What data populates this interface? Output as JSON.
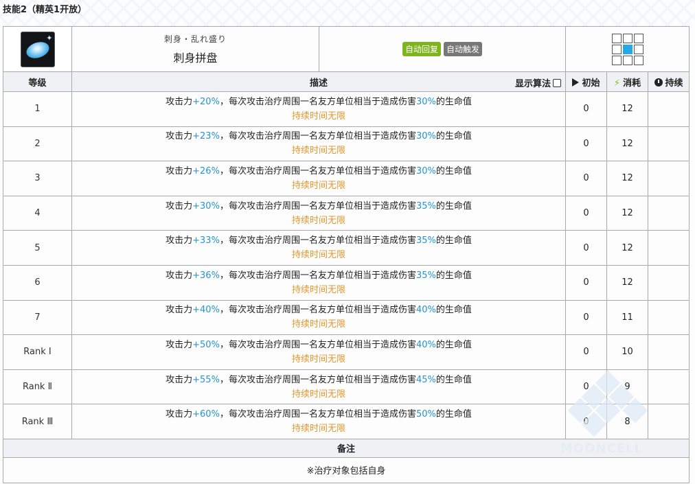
{
  "section_title": "技能2（精英1开放）",
  "skill": {
    "name_jp": "刺身・乱れ盛り",
    "name": "刺身拼盘",
    "tags": [
      {
        "label": "自动回复",
        "color": "#7cb51c"
      },
      {
        "label": "自动触发",
        "color": "#777777"
      }
    ],
    "icon": "sashimi-platter-icon",
    "range_grid": [
      [
        0,
        0,
        0
      ],
      [
        0,
        1,
        0
      ],
      [
        0,
        0,
        0
      ]
    ]
  },
  "columns": {
    "level": "等级",
    "desc": "描述",
    "show_algo": "显示算法",
    "initial": "初始",
    "cost": "消耗",
    "duration": "持续"
  },
  "levels": [
    {
      "level": "1",
      "atk": "+20%",
      "heal": "30%",
      "initial": "0",
      "cost": "12",
      "duration": ""
    },
    {
      "level": "2",
      "atk": "+23%",
      "heal": "30%",
      "initial": "0",
      "cost": "12",
      "duration": ""
    },
    {
      "level": "3",
      "atk": "+26%",
      "heal": "30%",
      "initial": "0",
      "cost": "12",
      "duration": ""
    },
    {
      "level": "4",
      "atk": "+30%",
      "heal": "35%",
      "initial": "0",
      "cost": "12",
      "duration": ""
    },
    {
      "level": "5",
      "atk": "+33%",
      "heal": "35%",
      "initial": "0",
      "cost": "12",
      "duration": ""
    },
    {
      "level": "6",
      "atk": "+36%",
      "heal": "35%",
      "initial": "0",
      "cost": "12",
      "duration": ""
    },
    {
      "level": "7",
      "atk": "+40%",
      "heal": "40%",
      "initial": "0",
      "cost": "11",
      "duration": ""
    },
    {
      "level": "Rank Ⅰ",
      "atk": "+50%",
      "heal": "40%",
      "initial": "0",
      "cost": "10",
      "duration": ""
    },
    {
      "level": "Rank Ⅱ",
      "atk": "+55%",
      "heal": "45%",
      "initial": "0",
      "cost": "9",
      "duration": ""
    },
    {
      "level": "Rank Ⅲ",
      "atk": "+60%",
      "heal": "50%",
      "initial": "0",
      "cost": "8",
      "duration": ""
    }
  ],
  "desc_text": {
    "pre": "攻击力",
    "mid": "，每次攻击治疗周围一名友方单位相当于造成伤害",
    "post": "的生命值",
    "duration_line": "持续时间无限"
  },
  "notes_header": "备注",
  "notes": "※治疗对象包括自身",
  "watermark": "MOONCELL",
  "colors": {
    "accent_blue": "#2493d3",
    "accent_orange": "#e3962d",
    "tag_green": "#7cb51c",
    "range_active": "#27a8e6"
  }
}
